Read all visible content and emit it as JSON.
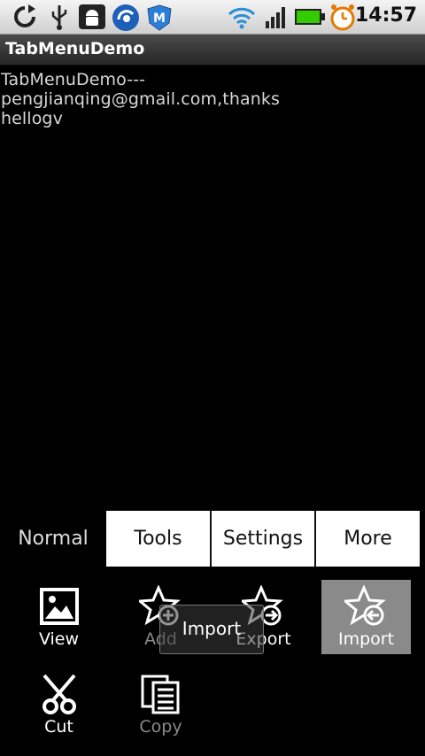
{
  "status_bar": {
    "time": "14:57",
    "icons": [
      "sync-icon",
      "usb-icon",
      "android-debug-icon",
      "app-swirl-icon",
      "shield-m-icon",
      "wifi-icon",
      "signal-icon",
      "battery-icon",
      "alarm-icon"
    ],
    "battery_color": "#33cc00"
  },
  "app": {
    "title": "TabMenuDemo",
    "content_line1": "TabMenuDemo---pengjianqing@gmail.com,thanks",
    "content_line2": "hellogv"
  },
  "tabs": [
    {
      "label": "Normal",
      "selected": true
    },
    {
      "label": "Tools",
      "selected": false
    },
    {
      "label": "Settings",
      "selected": false
    },
    {
      "label": "More",
      "selected": false
    }
  ],
  "menu_items": [
    {
      "label": "View",
      "icon": "picture-icon",
      "enabled": true,
      "highlighted": false
    },
    {
      "label": "Add",
      "icon": "star-add-icon",
      "enabled": false,
      "highlighted": false
    },
    {
      "label": "Export",
      "icon": "star-export-icon",
      "enabled": true,
      "highlighted": false
    },
    {
      "label": "Import",
      "icon": "star-import-icon",
      "enabled": true,
      "highlighted": true
    },
    {
      "label": "Cut",
      "icon": "scissors-icon",
      "enabled": true,
      "highlighted": false
    },
    {
      "label": "Copy",
      "icon": "copy-icon",
      "enabled": false,
      "highlighted": false
    }
  ],
  "toast": {
    "text": "Import"
  }
}
